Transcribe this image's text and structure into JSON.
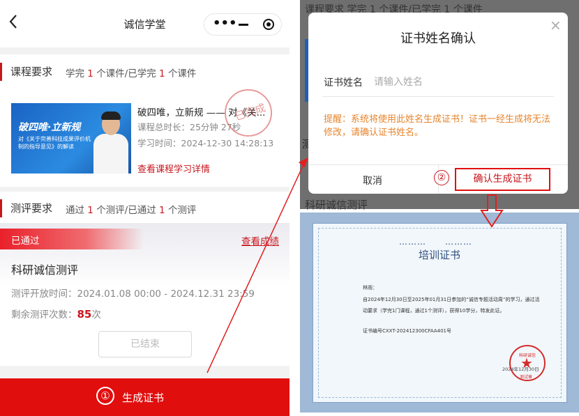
{
  "nav": {
    "title": "诚信学堂",
    "back_icon": "‹"
  },
  "course": {
    "header_label": "课程要求",
    "req_prefix": "学完",
    "req_n1": "1",
    "req_mid": "个课件/已学完",
    "req_n2": "1",
    "req_suffix": "个课件",
    "thumb_title": "破四唯·立新规",
    "thumb_sub": "对《关于完善科技成果评价机制的指导意见》的解读",
    "title": "破四唯，立新规 —— 对《关...",
    "duration": "课程总时长：25分钟 27秒",
    "study_time": "学习时间：2024-12-30 14:28:13",
    "detail_link": "查看课程学习详情",
    "seal_text": "已完成"
  },
  "test": {
    "header_label": "测评要求",
    "req_prefix": "通过",
    "req_n1": "1",
    "req_mid": "个测评/已通过",
    "req_n2": "1",
    "req_suffix": "个测评",
    "status_badge": "已通过",
    "view_score": "查看成绩",
    "name": "科研诚信测评",
    "open_time": "测评开放时间：2024.01.08 00:00 - 2024.12.31 23:59",
    "remain_label": "剩余测评次数：",
    "remain_count": "85",
    "remain_unit": "次",
    "ended_button": "已结束"
  },
  "generate": {
    "step": "①",
    "label": "生成证书"
  },
  "bg_page": {
    "text_top": "课程要求   学完 1 个课件/已学完 1 个课件",
    "text_bottom": "科研诚信测评",
    "letter": "测"
  },
  "dialog": {
    "title": "证书姓名确认",
    "close": "×",
    "name_label": "证书姓名",
    "name_placeholder": "请输入姓名",
    "tip": "提醒：系统将使用此姓名生成证书！证书一经生成将无法修改，请确认证书姓名。",
    "cancel": "取消",
    "step": "②",
    "confirm": "确认生成证书"
  },
  "certificate": {
    "title": "培训证书",
    "dots": "………",
    "name": "林雨：",
    "body": "自2024年12月30日至2025年01月31日参加的“诚信专题活动周”的学习，通过活动要求（学完1门课程，通过1个测评），获得10学分，特发此证。",
    "number": "证书编号CXXT-202412300CFAA401号",
    "seal_text": "科研诚信",
    "date": "2024年12月30日",
    "stamp": "测试章"
  },
  "colors": {
    "accent": "#c8161d",
    "bar_red": "#e10e0e",
    "tip_orange": "#e7842b",
    "cert_blue": "#2d4e7d"
  }
}
